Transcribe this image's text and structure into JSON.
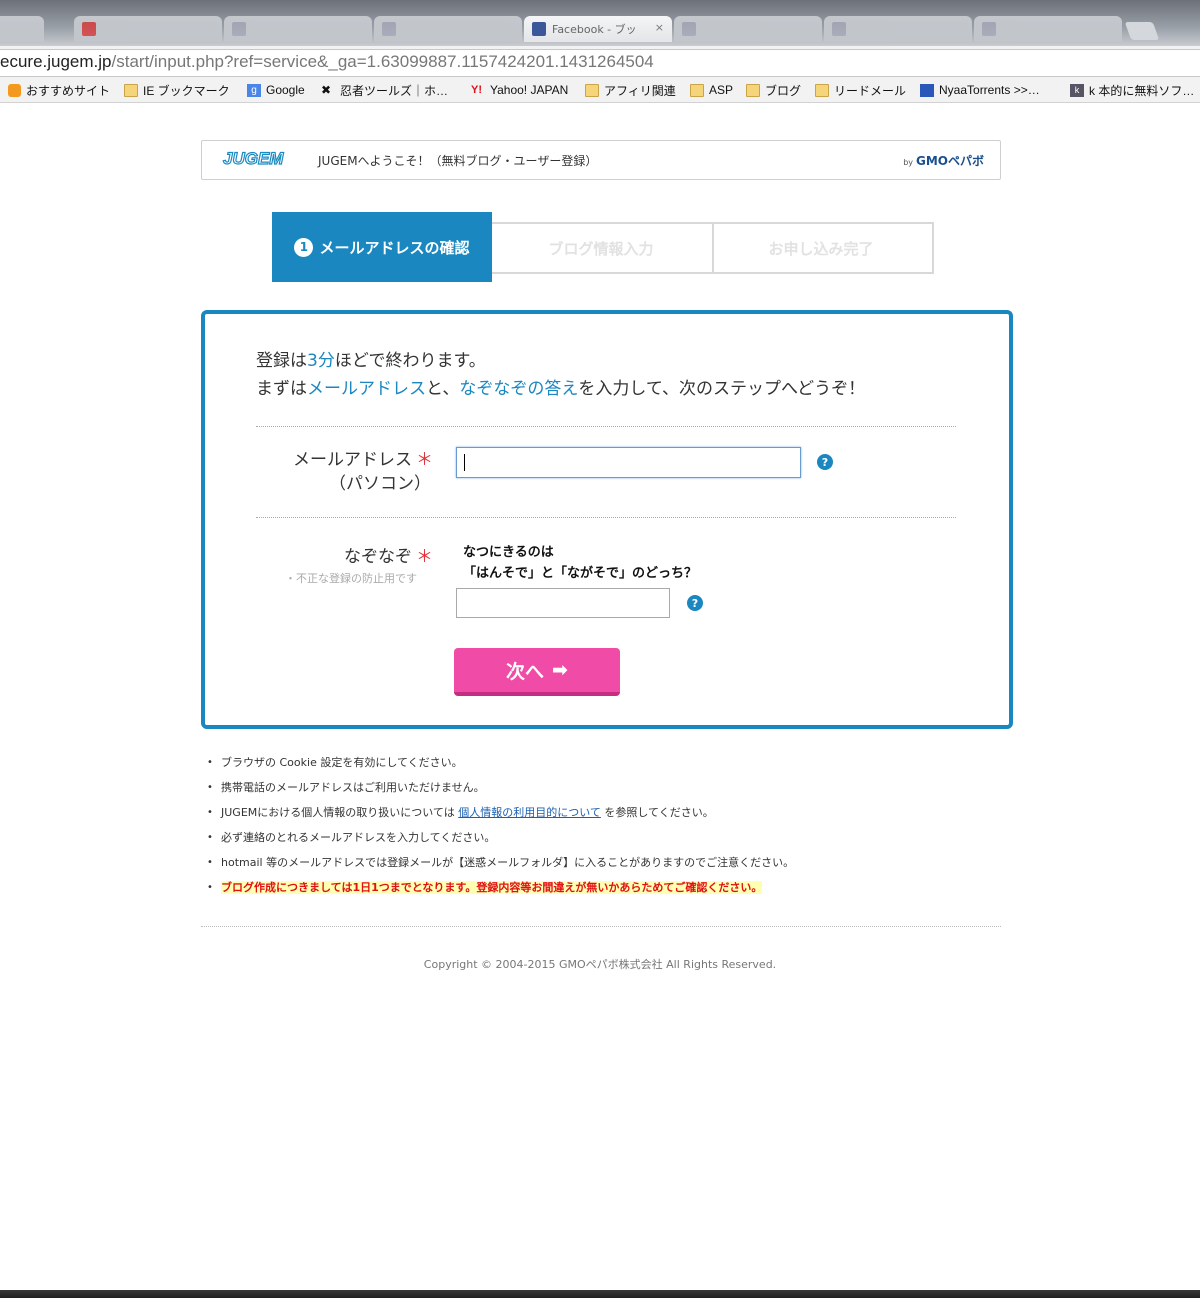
{
  "browser": {
    "address": {
      "host": "ecure.jugem.jp",
      "path": "/start/input.php?ref=service&_ga=1.63099887.1157424201.1431264504"
    },
    "active_tab_label": "Facebook - ブッ",
    "bookmarks": [
      {
        "label": "おすすめサイト",
        "icon": "bulb-icon"
      },
      {
        "label": "IE ブックマーク",
        "icon": "folder-icon"
      },
      {
        "label": "Google",
        "icon": "google-icon"
      },
      {
        "label": "忍者ツールズ｜ホ…",
        "icon": "ninja-icon"
      },
      {
        "label": "Yahoo! JAPAN",
        "icon": "yahoo-icon"
      },
      {
        "label": "アフィリ関連",
        "icon": "folder-icon"
      },
      {
        "label": "ASP",
        "icon": "folder-icon"
      },
      {
        "label": "ブログ",
        "icon": "folder-icon"
      },
      {
        "label": "リードメール",
        "icon": "folder-icon"
      },
      {
        "label": "NyaaTorrents >>…",
        "icon": "nyaa-icon"
      },
      {
        "label": "k 本的に無料ソフ…",
        "icon": "k-icon"
      }
    ]
  },
  "header": {
    "logo": "JUGEM",
    "welcome": "JUGEMへようこそ！（無料ブログ・ユーザー登録）",
    "by": "by",
    "company": "GMOペパボ"
  },
  "steps": {
    "active_number": "1",
    "active_label": "メールアドレスの確認",
    "step2": "ブログ情報入力",
    "step3": "お申し込み完了"
  },
  "form": {
    "intro_1a": "登録は",
    "intro_1b": "3分",
    "intro_1c": "ほどで終わります。",
    "intro_2a": "まずは",
    "intro_2b": "メールアドレス",
    "intro_2c": "と、",
    "intro_2d": "なぞなぞの答え",
    "intro_2e": "を入力して、次のステップへどうぞ！",
    "email_label": "メールアドレス",
    "email_label_sub": "（パソコン）",
    "required_mark": "＊",
    "email_value": "",
    "riddle_label": "なぞなぞ",
    "riddle_note": "・不正な登録の防止用です",
    "riddle_q1": "なつにきるのは",
    "riddle_q2": "「はんそで」と「ながそで」のどっち？",
    "riddle_value": "",
    "help_mark": "?",
    "next_button": "次へ",
    "next_arrow": "➡"
  },
  "notes": [
    "ブラウザの Cookie 設定を有効にしてください。",
    "携帯電話のメールアドレスはご利用いただけません。"
  ],
  "privacy_note": {
    "before": "JUGEMにおける個人情報の取り扱いについては ",
    "link": "個人情報の利用目的について",
    "after": " を参照してください。"
  },
  "notes2": [
    "必ず連絡のとれるメールアドレスを入力してください。",
    "hotmail 等のメールアドレスでは登録メールが【迷惑メールフォルダ】に入ることがありますのでご注意ください。"
  ],
  "warning": "ブログ作成につきましては1日1つまでとなります。登録内容等お間違えが無いかあらためてご確認ください。",
  "copyright": "Copyright © 2004-2015 GMOペパボ株式会社 All Rights Reserved.",
  "colors": {
    "accent": "#1a87c0",
    "button": "#f04ba6",
    "required": "#e0323a"
  }
}
